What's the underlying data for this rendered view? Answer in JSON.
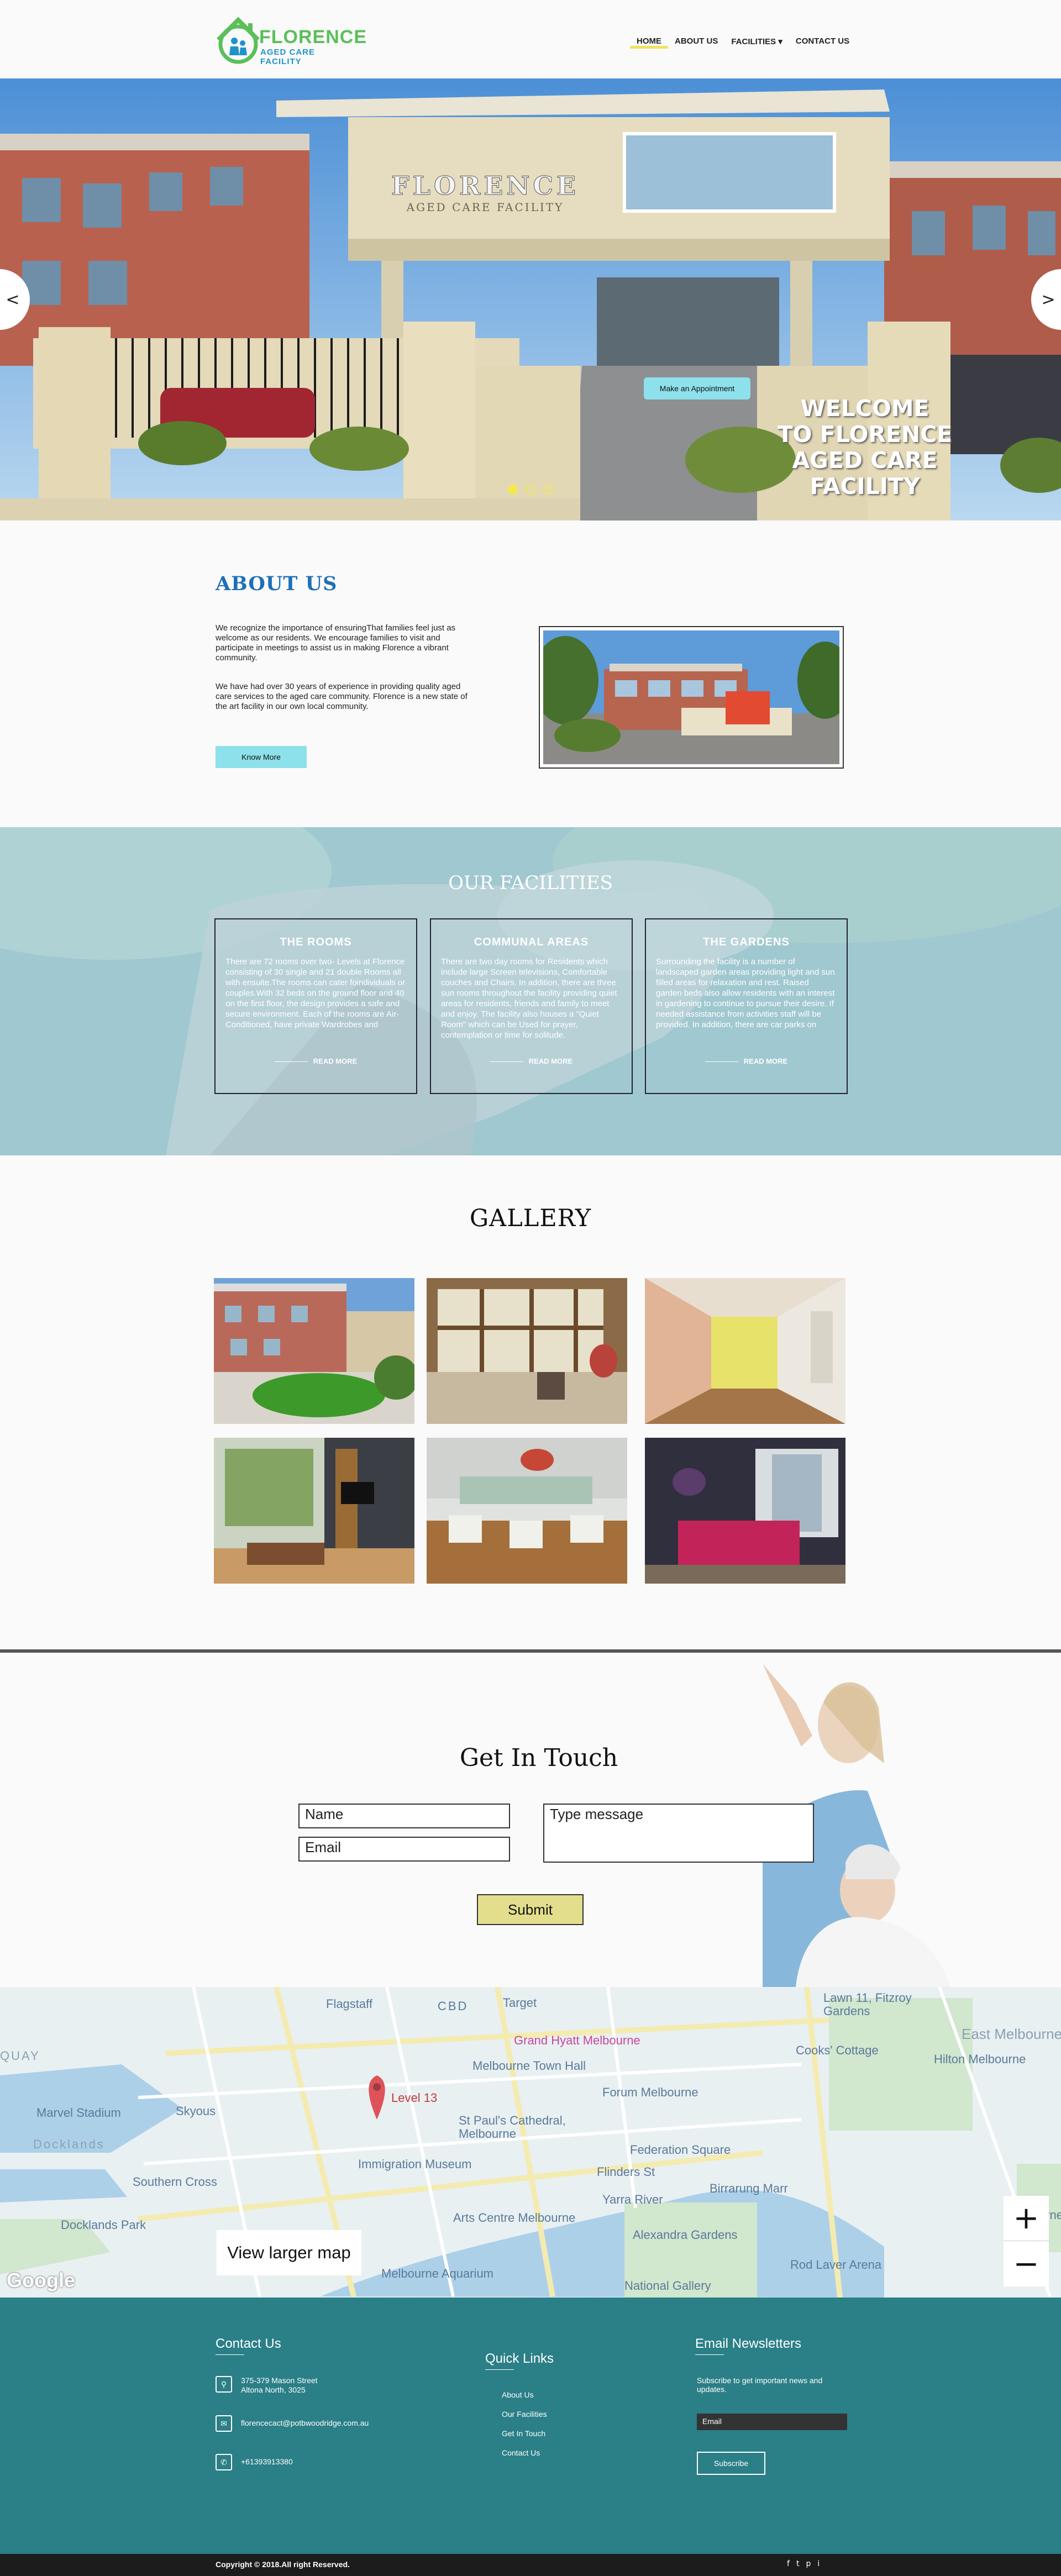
{
  "header": {
    "logo_line1": "FLORENCE",
    "logo_line2": "AGED CARE FACILITY",
    "nav": [
      {
        "label": "HOME",
        "active": true
      },
      {
        "label": "ABOUT US"
      },
      {
        "label": "FACILITIES ▾"
      },
      {
        "label": "CONTACT US"
      }
    ]
  },
  "hero": {
    "building_sign_1": "FLORENCE",
    "building_sign_2": "AGED CARE FACILITY",
    "appointment_label": "Make an Appointment",
    "welcome_lines": [
      "WELCOME",
      "TO FLORENCE",
      "AGED CARE FACILITY"
    ],
    "prev_label": "<",
    "next_label": ">",
    "slides": 3,
    "active_slide": 1
  },
  "about": {
    "title": "ABOUT US",
    "p1": "We recognize the importance of ensuringThat families feel just as welcome as our residents. We encourage families to visit and participate in meetings to assist us in making Florence a vibrant community.",
    "p2": "We have had over 30 years of experience in providing quality aged care services to the aged care community. Florence is a new state of the art facility in our own local community.",
    "button": "Know More"
  },
  "facilities": {
    "title": "OUR FACILITIES",
    "cards": [
      {
        "title": "THE ROOMS",
        "text": "There are 72 rooms over two- Levels at Florence consisting of 30 single and 21 double Rooms all with ensuite.The rooms can cater foindividuals or couples.With 32 beds on the ground floor and 40 on the first floor, the design provides a safe and secure environment. Each of the rooms are Air-Conditioned, have private Wardrobes and",
        "more": "READ MORE"
      },
      {
        "title": "COMMUNAL AREAS",
        "text": "There are two day rooms for Residents which include large Screen televisions, Comfortable couches and Chairs. In addition, there are three sun rooms throughout the facility providing quiet areas for residents, friends and family to meet and enjoy. The facility also houses a \"Quiet Room\" which can be Used for prayer, contemplation or time for solitude.",
        "more": "READ MORE"
      },
      {
        "title": "THE GARDENS",
        "text": "Surrounding the facility is a number of landscaped garden areas providing light and sun filled areas for relaxation and rest. Raised garden beds also allow residents with an interest in gardening to continue to pursue their desire. If needed assistance from activities staff will be provided. In addition, there are car parks on",
        "more": "READ MORE"
      }
    ]
  },
  "gallery": {
    "title": "GALLERY"
  },
  "contact": {
    "title": "Get In Touch",
    "name_placeholder": "Name",
    "email_placeholder": "Email",
    "message_placeholder": "Type message",
    "submit": "Submit"
  },
  "map": {
    "labels": [
      "Flagstaff",
      "CBD",
      "Target",
      "Grand Hyatt Melbourne",
      "Melbourne Town Hall",
      "Forum Melbourne",
      "Level 13",
      "Skyous",
      "St Paul's Cathedral, Melbourne",
      "Federation Square",
      "Immigration Museum",
      "Flinders St",
      "Southern Cross",
      "Docklands",
      "Docklands Park",
      "Marvel Stadium",
      "Yarra River",
      "Arts Centre Melbourne",
      "Birrarung Marr",
      "Alexandra Gardens",
      "Rod Laver Arena",
      "National Gallery",
      "Melbourne Aquarium",
      "Cooks' Cottage",
      "East Melbourne",
      "Hilton Melbourne",
      "Lawn 11, Fitzroy Gardens",
      "Melbourne Cricket",
      "QUAY"
    ],
    "larger_map": "View larger map",
    "zoom_in": "+",
    "zoom_out": "−",
    "google": "Google"
  },
  "footer": {
    "contact_title": "Contact Us",
    "address_line1": "375-379 Mason Street",
    "address_line2": "Altona North, 3025",
    "email": "florencecact@potbwoodridge.com.au",
    "phone": "+61393913380",
    "quick_title": "Quick Links",
    "quick_links": [
      "About Us",
      "Our Facilities",
      "Get In Touch",
      "Contact Us"
    ],
    "news_title": "Email Newsletters",
    "news_text": "Subscribe to get important news and updates.",
    "news_placeholder": "Email",
    "subscribe": "Subscribe",
    "copyright": "Copyright © 2018.All right Reserved.",
    "social": [
      "f",
      "t",
      "p",
      "i"
    ]
  }
}
